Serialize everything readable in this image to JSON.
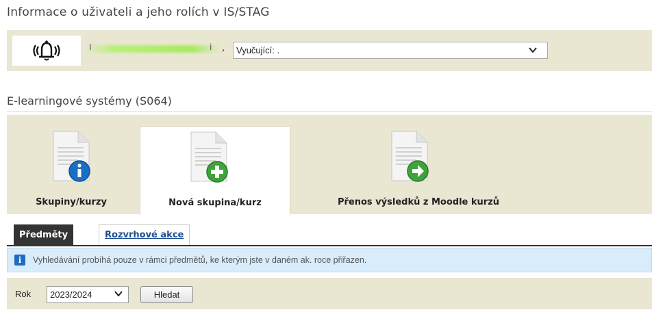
{
  "page": {
    "title": "Informace o uživateli a jeho rolích v IS/STAG"
  },
  "user_bar": {
    "notification_icon": "bell-ringing-icon",
    "name_fragment_1": "I",
    "name_fragment_2": "i",
    "name_separator": ",",
    "role_select": {
      "selected": "Vyučující: .",
      "icon": "chevron-down-icon"
    }
  },
  "section": {
    "title": "E-learningové systémy (S064)"
  },
  "tabs": [
    {
      "label": "Skupiny/kurzy",
      "icon": "document-info-icon",
      "overlay_color": "#1a6fc4",
      "active": false
    },
    {
      "label": "Nová skupina/kurz",
      "icon": "document-add-icon",
      "overlay_color": "#3fa33a",
      "active": true
    },
    {
      "label": "Přenos výsledků z Moodle kurzů",
      "icon": "document-forward-icon",
      "overlay_color": "#3fa33a",
      "active": false
    }
  ],
  "subtabs": {
    "active": "Předměty",
    "link": "Rozvrhové akce"
  },
  "info": {
    "icon": "info-icon",
    "text": "Vyhledávání probíhá pouze v rámci předmětů, ke kterým jste v daném ak. roce přiřazen."
  },
  "search": {
    "year_label": "Rok",
    "year_selected": "2023/2024",
    "button_label": "Hledat"
  },
  "colors": {
    "panel_background": "#e9e6d2",
    "info_background": "#d9ecfb",
    "link_color": "#1d4f91",
    "active_subtab": "#333333"
  }
}
